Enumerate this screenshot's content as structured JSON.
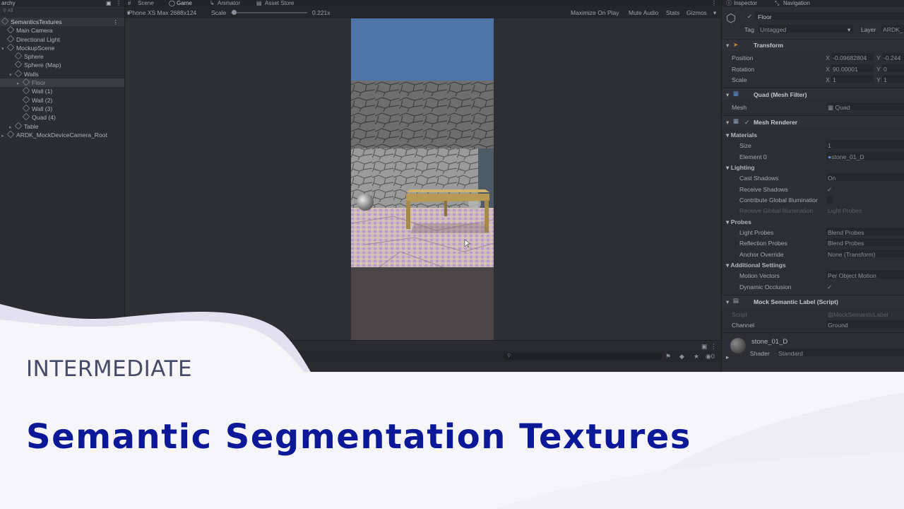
{
  "hierarchy": {
    "tab_label": "archy",
    "search_placeholder": "All",
    "scene_name": "SemanticsTextures",
    "items": [
      {
        "label": "Main Camera"
      },
      {
        "label": "Directional Light"
      },
      {
        "label": "MockupScene"
      },
      {
        "label": "Sphere"
      },
      {
        "label": "Sphere (Map)"
      },
      {
        "label": "Walls"
      },
      {
        "label": "Floor"
      },
      {
        "label": "Wall (1)"
      },
      {
        "label": "Wall (2)"
      },
      {
        "label": "Wall (3)"
      },
      {
        "label": "Quad (4)"
      },
      {
        "label": "Table"
      },
      {
        "label": "ARDK_MockDeviceCamera_Root"
      }
    ]
  },
  "view_tabs": {
    "scene": "Scene",
    "game": "Game",
    "animator": "Animator",
    "asset_store": "Asset Store"
  },
  "game_toolbar": {
    "resolution": "iPhone XS Max 2688x124",
    "scale_label": "Scale",
    "scale_value": "0.221x",
    "maximize": "Maximize On Play",
    "mute": "Mute Audio",
    "stats": "Stats",
    "gizmos": "Gizmos"
  },
  "console": {
    "count": "0"
  },
  "inspector": {
    "tabs": {
      "inspector": "Inspector",
      "navigation": "Navigation"
    },
    "object_name": "Floor",
    "tag_label": "Tag",
    "tag_value": "Untagged",
    "layer_label": "Layer",
    "layer_value": "ARDK_",
    "transform": {
      "header": "Transform",
      "position_label": "Position",
      "position_x": "-0.09682804",
      "position_y": "-0.244",
      "rotation_label": "Rotation",
      "rotation_x": "90.00001",
      "rotation_y": "0",
      "scale_label": "Scale",
      "scale_x": "1",
      "scale_y": "1",
      "x": "X",
      "y": "Y"
    },
    "mesh_filter": {
      "header": "Quad (Mesh Filter)",
      "mesh_label": "Mesh",
      "mesh_value": "Quad"
    },
    "mesh_renderer": {
      "header": "Mesh Renderer",
      "materials": "Materials",
      "size_label": "Size",
      "size_value": "1",
      "element_label": "Element 0",
      "element_value": "stone_01_D",
      "lighting": "Lighting",
      "cast_shadows_label": "Cast Shadows",
      "cast_shadows_value": "On",
      "receive_shadows_label": "Receive Shadows",
      "contribute_gi_label": "Contribute Global Illuminatior",
      "receive_gi_label": "Receive Global Illumination",
      "receive_gi_value": "Light Probes",
      "probes": "Probes",
      "light_probes_label": "Light Probes",
      "light_probes_value": "Blend Probes",
      "reflection_probes_label": "Reflection Probes",
      "reflection_probes_value": "Blend Probes",
      "anchor_override_label": "Anchor Override",
      "anchor_override_value": "None (Transform)",
      "additional": "Additional Settings",
      "motion_vectors_label": "Motion Vectors",
      "motion_vectors_value": "Per Object Motion",
      "dynamic_occlusion_label": "Dynamic Occlusion"
    },
    "semantic_label": {
      "header": "Mock Semantic Label (Script)",
      "script_label": "Script",
      "script_value": "MockSemanticLabel",
      "channel_label": "Channel",
      "channel_value": "Ground"
    },
    "material": {
      "name": "stone_01_D",
      "shader_label": "Shader",
      "shader_value": "Standard"
    }
  },
  "banner": {
    "level": "INTERMEDIATE",
    "title": "Semantic Segmentation Textures"
  },
  "colors": {
    "title": "#0b1897",
    "level": "#474a66",
    "banner_bg": "#f6f6f8"
  }
}
